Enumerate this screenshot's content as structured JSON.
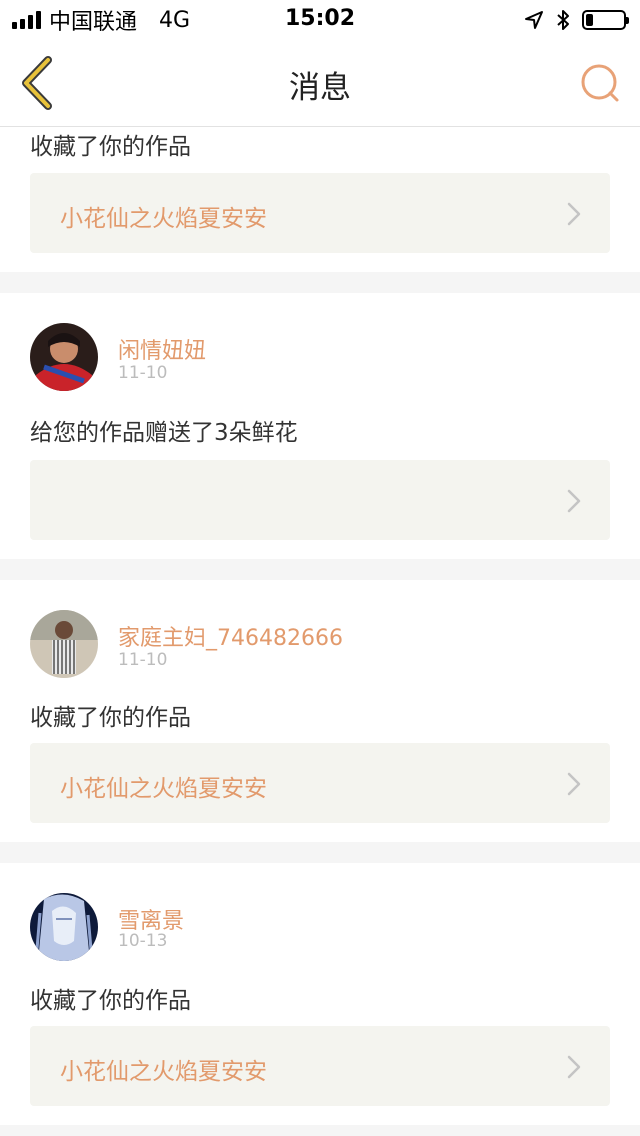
{
  "status_bar": {
    "carrier": "中国联通",
    "network": "4G",
    "time": "15:02",
    "battery_level": 0.2
  },
  "nav": {
    "title": "消息"
  },
  "messages": [
    {
      "action": "收藏了你的作品",
      "work_title": "小花仙之火焰夏安安"
    },
    {
      "username": "闲情妞妞",
      "date": "11-10",
      "action": "给您的作品赠送了3朵鲜花",
      "work_title": ""
    },
    {
      "username": "家庭主妇_746482666",
      "date": "11-10",
      "action": "收藏了你的作品",
      "work_title": "小花仙之火焰夏安安"
    },
    {
      "username": "雪离景",
      "date": "10-13",
      "action": "收藏了你的作品",
      "work_title": "小花仙之火焰夏安安"
    }
  ],
  "colors": {
    "accent": "#e29a6c",
    "back_arrow": "#e8c23a",
    "card_bg": "#ffffff",
    "work_box_bg": "#f4f4ef",
    "page_bg": "#f5f5f5"
  },
  "icons": {
    "back": "chevron-left-icon",
    "search": "search-icon",
    "item_arrow": "chevron-right-icon",
    "location": "location-arrow-icon",
    "bluetooth": "bluetooth-icon",
    "battery": "battery-icon",
    "signal": "signal-icon"
  }
}
